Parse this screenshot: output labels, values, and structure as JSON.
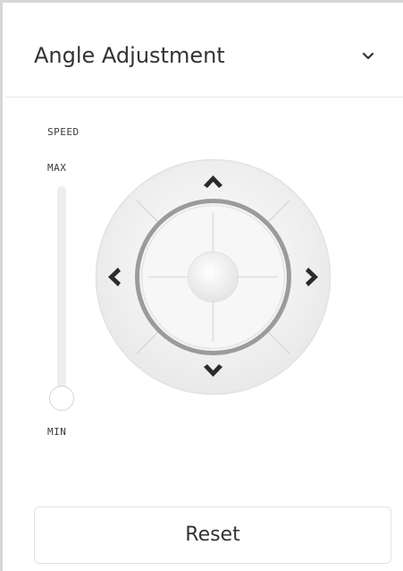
{
  "panel": {
    "title": "Angle Adjustment",
    "collapse_icon": "chevron-down-icon"
  },
  "speed": {
    "label": "SPEED",
    "max_label": "MAX",
    "min_label": "MIN",
    "value": 0
  },
  "joystick": {
    "up_icon": "arrow-up-icon",
    "down_icon": "arrow-down-icon",
    "left_icon": "arrow-left-icon",
    "right_icon": "arrow-right-icon",
    "center_icon": "center-knob-icon"
  },
  "reset": {
    "label": "Reset"
  },
  "colors": {
    "text": "#333333",
    "border": "#d6d6d6",
    "arrow": "#2b2b2b"
  }
}
